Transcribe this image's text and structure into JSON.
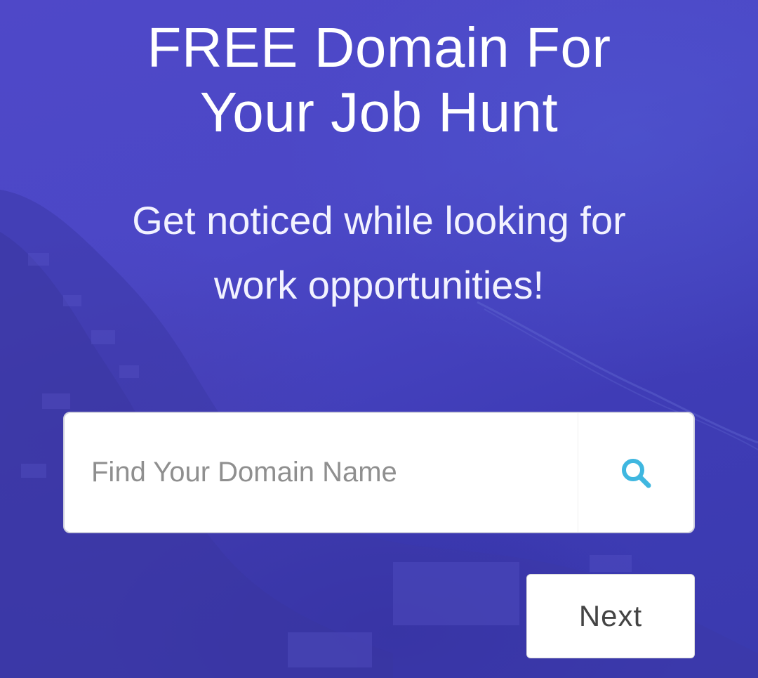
{
  "hero": {
    "title_line1": "FREE Domain For",
    "title_line2": "Your Job Hunt",
    "subtitle_line1": "Get noticed while looking for",
    "subtitle_line2": "work opportunities!"
  },
  "search": {
    "placeholder": "Find Your Domain Name",
    "value": "",
    "icon": "search-icon"
  },
  "actions": {
    "next_label": "Next"
  },
  "colors": {
    "background": "#4a45c4",
    "accent_icon": "#3fb7e0",
    "button_text": "#444444"
  }
}
